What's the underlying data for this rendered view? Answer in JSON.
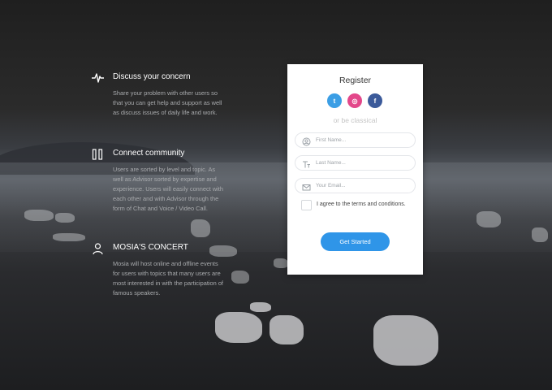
{
  "features": [
    {
      "icon": "pulse-icon",
      "title": "Discuss your concern",
      "text": "Share your problem with other users so that you can get help and support as well as discuss issues of daily life and work."
    },
    {
      "icon": "columns-icon",
      "title": "Connect community",
      "text": "Users are sorted by level and topic. As well as Advisor sorted by expertise and experience. Users will easily connect with each other and with Advisor through the form of Chat and Voice / Video Call."
    },
    {
      "icon": "user-icon",
      "title": "MOSIA'S CONCERT",
      "text": "Mosia will host online and offline events for users with topics that many users are most interested in with the participation of famous speakers."
    }
  ],
  "register": {
    "title": "Register",
    "social": [
      {
        "name": "twitter",
        "letter": "t",
        "color": "#3b9ee5"
      },
      {
        "name": "dribbble",
        "letter": "◎",
        "color": "#e3478a"
      },
      {
        "name": "facebook",
        "letter": "f",
        "color": "#3b5a9a"
      }
    ],
    "subtitle": "or be classical",
    "fields": {
      "first_name": {
        "placeholder": "First Name...",
        "icon": "face-icon"
      },
      "last_name": {
        "placeholder": "Last Name...",
        "icon": "text-icon"
      },
      "email": {
        "placeholder": "Your Email...",
        "icon": "mail-icon"
      }
    },
    "terms": "I agree to the terms and conditions.",
    "button": "Get Started",
    "accent": "#2f95e8"
  }
}
